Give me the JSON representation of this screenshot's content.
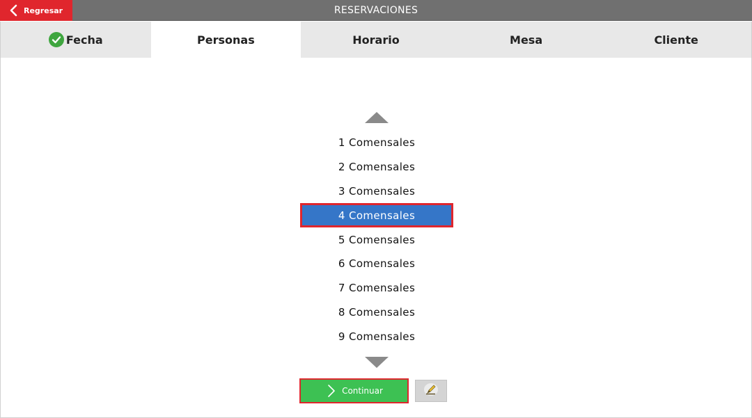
{
  "header": {
    "title": "RESERVACIONES",
    "back_label": "Regresar",
    "back_icon": "chevron-left-icon"
  },
  "tabs": [
    {
      "label": "Fecha",
      "completed": true,
      "active": false
    },
    {
      "label": "Personas",
      "completed": false,
      "active": true
    },
    {
      "label": "Horario",
      "completed": false,
      "active": false
    },
    {
      "label": "Mesa",
      "completed": false,
      "active": false
    },
    {
      "label": "Cliente",
      "completed": false,
      "active": false
    }
  ],
  "picker": {
    "options": [
      "1 Comensales",
      "2 Comensales",
      "3 Comensales",
      "4 Comensales",
      "5 Comensales",
      "6 Comensales",
      "7 Comensales",
      "8 Comensales",
      "9 Comensales"
    ],
    "selected_index": 3
  },
  "actions": {
    "continue_label": "Continuar",
    "edit_icon": "pencil-icon"
  },
  "colors": {
    "accent_red": "#e0262d",
    "title_bar": "#707070",
    "selected_blue": "#3576c8",
    "continue_green": "#3dc153",
    "check_green": "#3fa63f"
  }
}
